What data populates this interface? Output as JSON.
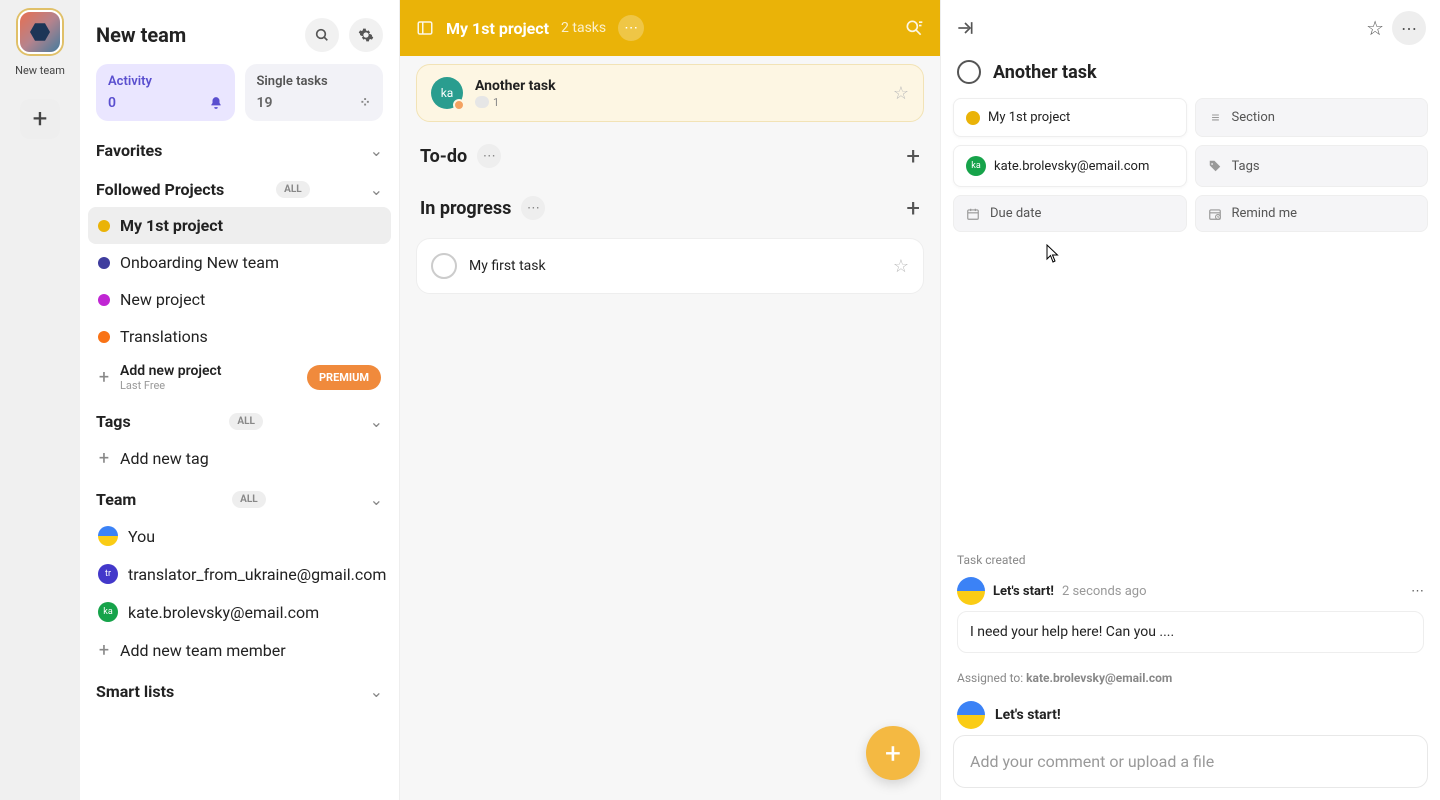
{
  "rail": {
    "team_label": "New team"
  },
  "sidebar": {
    "title": "New team",
    "cards": {
      "activity": {
        "label": "Activity",
        "count": "0"
      },
      "single": {
        "label": "Single tasks",
        "count": "19"
      }
    },
    "sections": {
      "favorites": "Favorites",
      "followed": "Followed Projects",
      "tags_h": "Tags",
      "team_h": "Team",
      "smart": "Smart lists"
    },
    "all_pill": "ALL",
    "projects": [
      {
        "name": "My 1st project",
        "color": "#eab308",
        "selected": true
      },
      {
        "name": "Onboarding New team",
        "color": "#3f3d9e",
        "selected": false
      },
      {
        "name": "New project",
        "color": "#c026d3",
        "selected": false
      },
      {
        "name": "Translations",
        "color": "#f97316",
        "selected": false
      }
    ],
    "add_project": {
      "label": "Add new project",
      "sub": "Last Free",
      "premium": "PREMIUM"
    },
    "tags": {
      "add": "Add new tag"
    },
    "team": [
      {
        "label": "You",
        "bg": "linear-gradient(180deg,#3b82f6 50%,#facc15 50%)",
        "txt": ""
      },
      {
        "label": "translator_from_ukraine@gmail.com",
        "bg": "#4338ca",
        "txt": "tr"
      },
      {
        "label": "kate.brolevsky@email.com",
        "bg": "#16a34a",
        "txt": "ka"
      }
    ],
    "add_member": "Add new team member"
  },
  "center": {
    "project_title": "My 1st project",
    "task_count": "2 tasks",
    "highlight_task": {
      "title": "Another task",
      "meta_count": "1",
      "avatar_txt": "ka"
    },
    "sections": [
      {
        "name": "To-do",
        "tasks": []
      },
      {
        "name": "In progress",
        "tasks": [
          {
            "title": "My first task"
          }
        ]
      }
    ]
  },
  "detail": {
    "title": "Another task",
    "chips": {
      "project": "My 1st project",
      "section_ph": "Section",
      "assignee": "kate.brolevsky@email.com",
      "tags_ph": "Tags",
      "due_ph": "Due date",
      "remind_ph": "Remind me"
    },
    "activity_label": "Task created",
    "comment": {
      "user": "Let's start!",
      "time": "2 seconds ago",
      "body": "I need your help here! Can you ...."
    },
    "assigned_prefix": "Assigned to: ",
    "assigned_to": "kate.brolevsky@email.com",
    "input_user": "Let's start!",
    "input_ph": "Add your comment or upload a file"
  },
  "colors": {
    "accent": "#eab308",
    "green": "#16a34a"
  }
}
